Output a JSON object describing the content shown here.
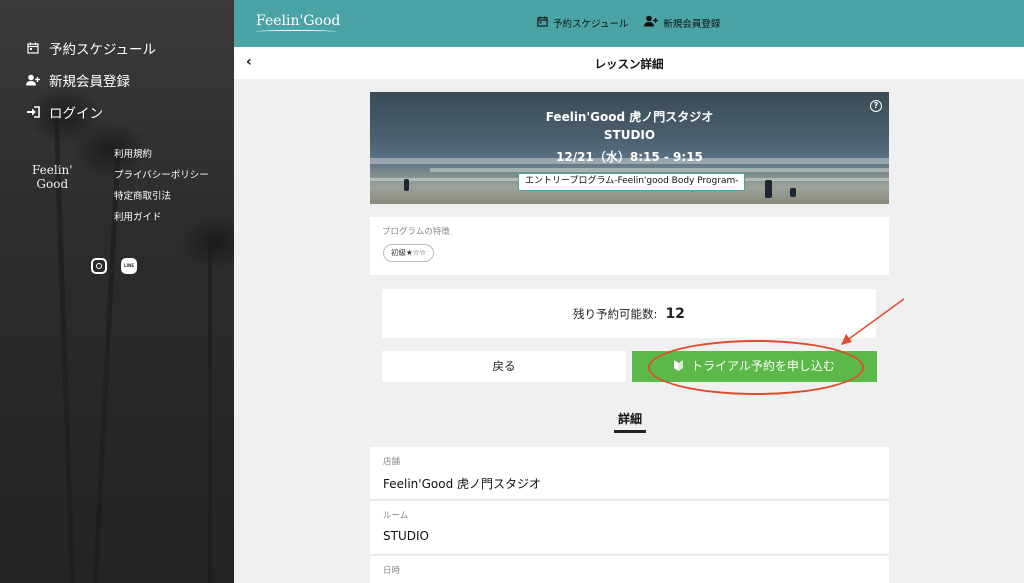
{
  "sidebar": {
    "nav": [
      {
        "label": "予約スケジュール",
        "icon": "calendar-icon"
      },
      {
        "label": "新規会員登録",
        "icon": "add-user-icon"
      },
      {
        "label": "ログイン",
        "icon": "login-icon"
      }
    ],
    "logo_line1": "Feelin'",
    "logo_line2": "Good",
    "links": [
      "利用規約",
      "プライバシーポリシー",
      "特定商取引法",
      "利用ガイド"
    ],
    "social": [
      "instagram-icon",
      "line-icon"
    ],
    "line_text": "LINE"
  },
  "topbar": {
    "logo": "Feelin'Good",
    "nav": [
      {
        "label": "予約スケジュール",
        "icon": "calendar-icon"
      },
      {
        "label": "新規会員登録",
        "icon": "add-user-icon"
      }
    ],
    "color": "#4aa3a5"
  },
  "subheader": {
    "title": "レッスン詳細",
    "back_icon": "‹"
  },
  "banner": {
    "studio": "Feelin'Good 虎ノ門スタジオ",
    "room": "STUDIO",
    "datetime": "12/21（水）8:15 - 9:15",
    "program": "エントリープログラム-Feelin'good Body Program-",
    "help_icon": "?"
  },
  "features": {
    "label": "プログラムの特徴",
    "tag": "初級★☆☆"
  },
  "remaining": {
    "label": "残り予約可能数:",
    "count": "12"
  },
  "buttons": {
    "back": "戻る",
    "trial": "トライアル予約を申し込む",
    "trial_color": "#5cb848"
  },
  "detail": {
    "heading": "詳細",
    "rows": [
      {
        "label": "店舗",
        "value": "Feelin'Good 虎ノ門スタジオ"
      },
      {
        "label": "ルーム",
        "value": "STUDIO"
      },
      {
        "label": "日時",
        "value": ""
      }
    ]
  },
  "annotation_color": "#e04b2e"
}
